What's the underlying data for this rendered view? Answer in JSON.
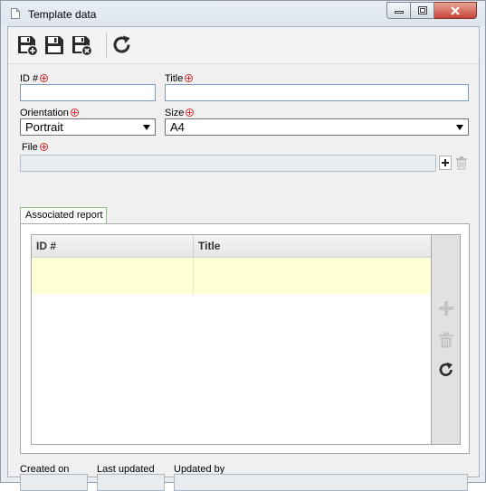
{
  "window": {
    "title": "Template data",
    "icons": {
      "document": "document-icon",
      "minimize": "minimize-icon",
      "maximize": "maximize-icon",
      "close": "close-icon"
    }
  },
  "toolbar": {
    "buttons": [
      {
        "name": "save-and-new",
        "icon": "save-plus-icon"
      },
      {
        "name": "save",
        "icon": "save-icon"
      },
      {
        "name": "save-and-close",
        "icon": "save-close-icon"
      },
      {
        "name": "refresh",
        "icon": "refresh-icon"
      }
    ]
  },
  "form": {
    "id": {
      "label": "ID #",
      "value": "",
      "required": true
    },
    "title": {
      "label": "Title",
      "value": "",
      "required": true
    },
    "orientation": {
      "label": "Orientation",
      "value": "Portrait",
      "required": true
    },
    "size": {
      "label": "Size",
      "value": "A4",
      "required": true
    },
    "file": {
      "label": "File",
      "value": "",
      "required": true
    }
  },
  "tabs": [
    {
      "label": "Associated report",
      "active": true
    }
  ],
  "grid": {
    "columns": [
      "ID #",
      "Title"
    ],
    "rows": [
      {
        "id": "",
        "title": ""
      }
    ],
    "side_buttons": [
      {
        "icon": "plus-icon",
        "enabled": false
      },
      {
        "icon": "trash-icon",
        "enabled": false
      },
      {
        "icon": "refresh-icon",
        "enabled": true
      }
    ]
  },
  "footer": {
    "created_on": {
      "label": "Created on",
      "value": ""
    },
    "last_updated": {
      "label": "Last updated",
      "value": ""
    },
    "updated_by": {
      "label": "Updated by",
      "value": ""
    }
  },
  "colors": {
    "required": "#d8262c",
    "selected_row": "#ffffd5",
    "tab_border": "#8fbf7f"
  }
}
